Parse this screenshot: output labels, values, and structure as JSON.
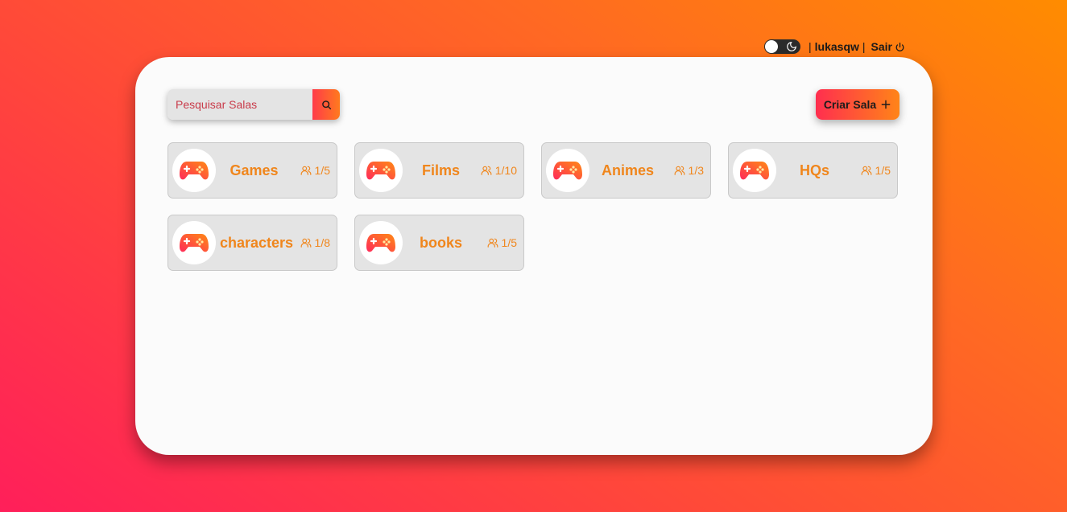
{
  "header": {
    "username": "lukasqw",
    "separator": "|",
    "logout_label": "Sair",
    "theme_toggle_icon": "moon-icon"
  },
  "search": {
    "placeholder": "Pesquisar Salas",
    "button_icon": "search-icon"
  },
  "create_button": {
    "label": "Criar Sala",
    "icon": "plus-icon"
  },
  "rooms": [
    {
      "name": "Games",
      "count": "1/5",
      "icon": "gamepad-icon"
    },
    {
      "name": "Films",
      "count": "1/10",
      "icon": "gamepad-icon"
    },
    {
      "name": "Animes",
      "count": "1/3",
      "icon": "gamepad-icon"
    },
    {
      "name": "HQs",
      "count": "1/5",
      "icon": "gamepad-icon"
    },
    {
      "name": "characters",
      "count": "1/8",
      "icon": "gamepad-icon"
    },
    {
      "name": "books",
      "count": "1/5",
      "icon": "gamepad-icon"
    }
  ],
  "colors": {
    "accent_start": "#ff2e4f",
    "accent_end": "#ff8418",
    "room_text": "#f0861c"
  }
}
